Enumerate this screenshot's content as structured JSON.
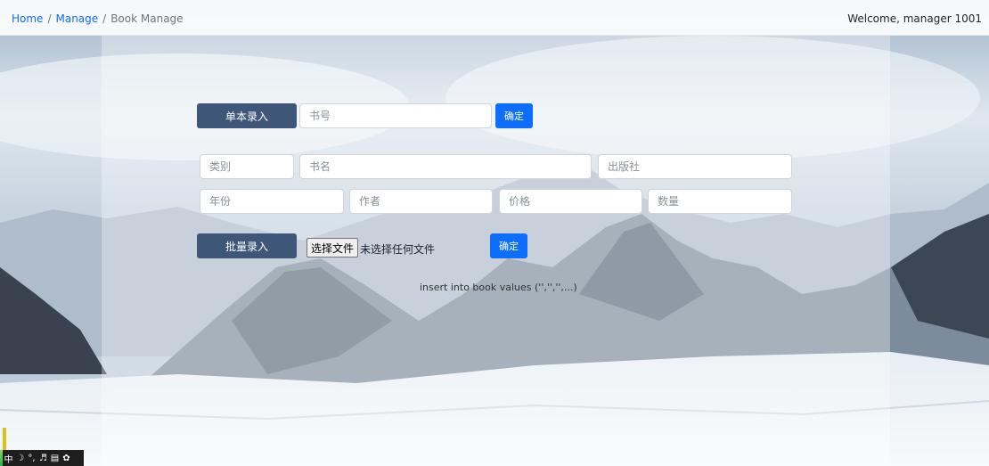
{
  "breadcrumb": {
    "home": "Home",
    "manage": "Manage",
    "current": "Book Manage",
    "separator": "/"
  },
  "welcome": "Welcome, manager 1001",
  "single_entry": {
    "button": "单本录入",
    "isbn_placeholder": "书号",
    "confirm": "确定"
  },
  "fields": {
    "category": "类别",
    "title": "书名",
    "publisher": "出版社",
    "year": "年份",
    "author": "作者",
    "price": "价格",
    "quantity": "数量"
  },
  "batch_entry": {
    "button": "批量录入",
    "choose_file": "选择文件",
    "no_file": "未选择任何文件",
    "confirm": "确定"
  },
  "sql_hint": "insert into book values ('','','',...)",
  "ime_toolbar": {
    "lang": "中",
    "icons": [
      "moon-icon",
      "punctuation-icon",
      "microphone-icon",
      "keyboard-icon",
      "settings-icon"
    ]
  },
  "colors": {
    "accent": "#0d6efd",
    "dark_button": "#3e5778"
  }
}
